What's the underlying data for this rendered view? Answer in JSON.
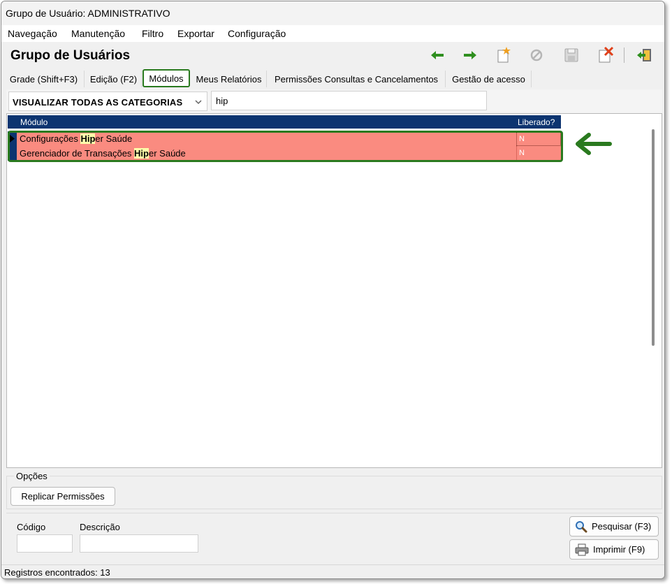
{
  "window": {
    "title": "Grupo de Usuário: ADMINISTRATIVO"
  },
  "menu": [
    "Navegação",
    "Manutenção",
    "Filtro",
    "Exportar",
    "Configuração"
  ],
  "header": {
    "title": "Grupo de Usuários"
  },
  "toolbar": {
    "icons": [
      "arrow-left-icon",
      "arrow-right-icon",
      "new-record-icon",
      "cancel-icon",
      "save-icon",
      "delete-icon",
      "exit-icon"
    ],
    "colors": {
      "nav_arrow": "#2f8f1f",
      "new_star": "#f0a020",
      "delete_x": "#e0401a"
    }
  },
  "tabs": [
    {
      "label": "Grade (Shift+F3)",
      "active": false
    },
    {
      "label": "Edição (F2)",
      "active": false
    },
    {
      "label": "Módulos",
      "active": true
    },
    {
      "label": "Meus Relatórios",
      "active": false
    },
    {
      "label": "Permissões Consultas e Cancelamentos",
      "active": false
    },
    {
      "label": "Gestão de acesso",
      "active": false
    }
  ],
  "filter": {
    "category": "VISUALIZAR TODAS AS CATEGORIAS",
    "search_value": "hip"
  },
  "grid": {
    "columns": [
      "Módulo",
      "Liberado?"
    ],
    "rows": [
      {
        "module_before": "Configurações ",
        "module_match": "Hip",
        "module_after": "er Saúde",
        "liberado": "N"
      },
      {
        "module_before": "Gerenciador de Transações ",
        "module_match": "Hip",
        "module_after": "er Saúde",
        "liberado": "N"
      }
    ],
    "colors": {
      "header": "#0c3470",
      "row_unreleased": "#fa8b80",
      "match_highlight": "#ffffaa",
      "annotation": "#2a7a1f"
    }
  },
  "options": {
    "legend": "Opções",
    "replicate_button": "Replicar Permissões"
  },
  "bottom": {
    "code_label": "Código",
    "description_label": "Descrição",
    "code_value": "",
    "description_value": "",
    "search_button": "Pesquisar (F3)",
    "print_button": "Imprimir (F9)"
  },
  "status": {
    "text": "Registros encontrados: 13"
  }
}
